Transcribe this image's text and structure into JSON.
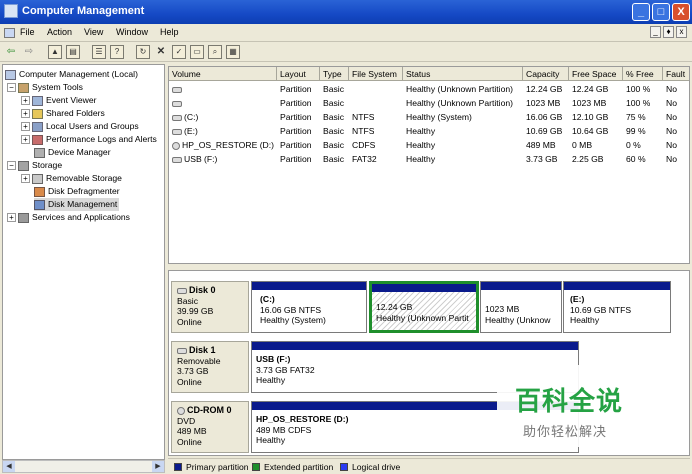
{
  "window": {
    "title": "Computer Management",
    "minimize": "_",
    "maximize": "□",
    "close": "X"
  },
  "menu": [
    "File",
    "Action",
    "View",
    "Window",
    "Help"
  ],
  "mdi_controls": [
    "_",
    "♦",
    "x"
  ],
  "tree": {
    "root": "Computer Management (Local)",
    "system_tools": "System Tools",
    "event_viewer": "Event Viewer",
    "shared_folders": "Shared Folders",
    "local_users": "Local Users and Groups",
    "perf_logs": "Performance Logs and Alerts",
    "device_manager": "Device Manager",
    "storage": "Storage",
    "removable_storage": "Removable Storage",
    "disk_defrag": "Disk Defragmenter",
    "disk_management": "Disk Management",
    "services": "Services and Applications"
  },
  "volumes": {
    "columns": [
      "Volume",
      "Layout",
      "Type",
      "File System",
      "Status",
      "Capacity",
      "Free Space",
      "% Free",
      "Fault"
    ],
    "rows": [
      [
        "",
        "Partition",
        "Basic",
        "",
        "Healthy (Unknown Partition)",
        "12.24 GB",
        "12.24 GB",
        "100 %",
        "No"
      ],
      [
        "",
        "Partition",
        "Basic",
        "",
        "Healthy (Unknown Partition)",
        "1023 MB",
        "1023 MB",
        "100 %",
        "No"
      ],
      [
        "(C:)",
        "Partition",
        "Basic",
        "NTFS",
        "Healthy (System)",
        "16.06 GB",
        "12.10 GB",
        "75 %",
        "No"
      ],
      [
        "(E:)",
        "Partition",
        "Basic",
        "NTFS",
        "Healthy",
        "10.69 GB",
        "10.64 GB",
        "99 %",
        "No"
      ],
      [
        "HP_OS_RESTORE (D:)",
        "Partition",
        "Basic",
        "CDFS",
        "Healthy",
        "489 MB",
        "0 MB",
        "0 %",
        "No"
      ],
      [
        "USB (F:)",
        "Partition",
        "Basic",
        "FAT32",
        "Healthy",
        "3.73 GB",
        "2.25 GB",
        "60 %",
        "No"
      ]
    ]
  },
  "disks": {
    "disk0": {
      "name": "Disk 0",
      "type": "Basic",
      "size": "39.99 GB",
      "state": "Online",
      "c": {
        "title": "(C:)",
        "size": "16.06 GB NTFS",
        "status": "Healthy (System)"
      },
      "p1": {
        "size": "12.24 GB",
        "status": "Healthy (Unknown Partit"
      },
      "p2": {
        "size": "1023 MB",
        "status": "Healthy (Unknow"
      },
      "e": {
        "title": "(E:)",
        "size": "10.69 GB NTFS",
        "status": "Healthy"
      }
    },
    "disk1": {
      "name": "Disk 1",
      "type": "Removable",
      "size": "3.73 GB",
      "state": "Online",
      "usb": {
        "title": "USB  (F:)",
        "size": "3.73 GB FAT32",
        "status": "Healthy"
      }
    },
    "cdrom0": {
      "name": "CD-ROM 0",
      "type": "DVD",
      "size": "489 MB",
      "state": "Online",
      "d": {
        "title": "HP_OS_RESTORE  (D:)",
        "size": "489 MB CDFS",
        "status": "Healthy"
      }
    }
  },
  "legend": {
    "primary": "Primary partition",
    "extended": "Extended partition",
    "logical": "Logical drive"
  },
  "colors": {
    "primary": "#0a1a8c",
    "extended": "#1f8f2c",
    "logical": "#2b3cf2"
  },
  "watermark": {
    "big": "百科全说",
    "small": "助你轻松解决"
  }
}
